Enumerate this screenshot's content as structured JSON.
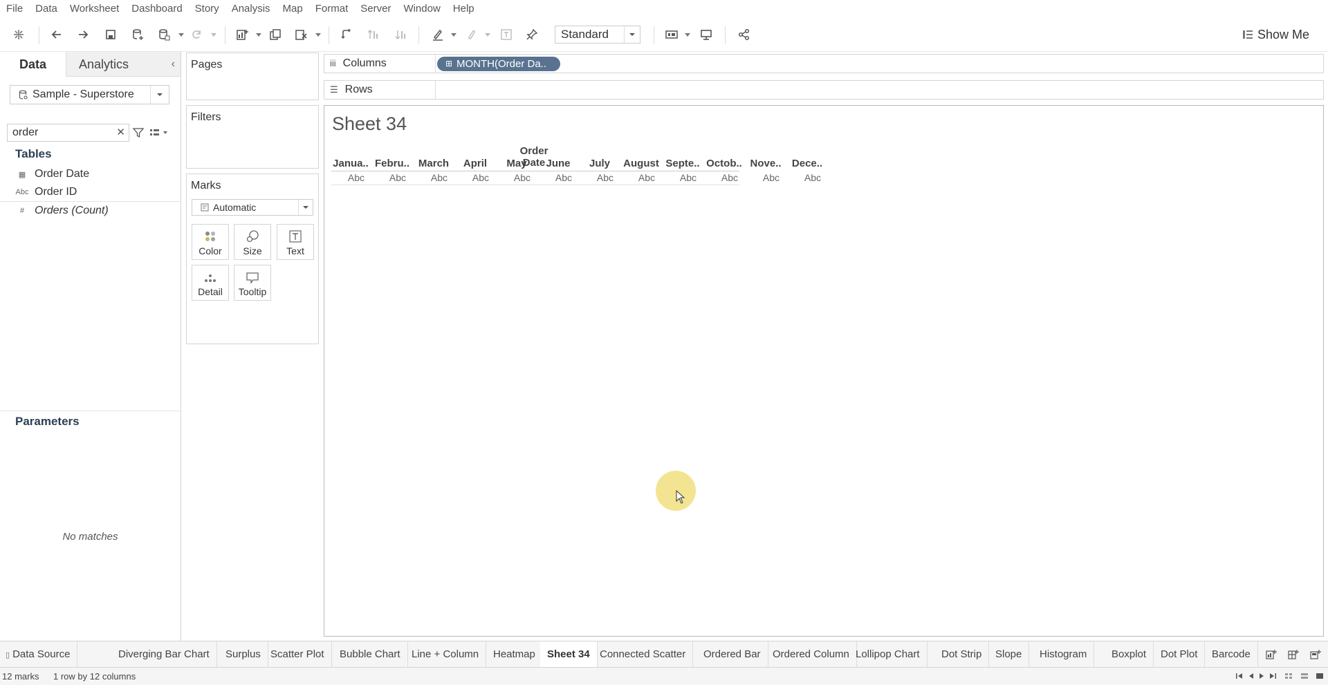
{
  "menu": [
    "File",
    "Data",
    "Worksheet",
    "Dashboard",
    "Story",
    "Analysis",
    "Map",
    "Format",
    "Server",
    "Window",
    "Help"
  ],
  "toolbar": {
    "fit_value": "Standard",
    "show_me_label": "Show Me"
  },
  "left_pane": {
    "tab_data": "Data",
    "tab_analytics": "Analytics",
    "collapse_glyph": "‹",
    "datasource": "Sample - Superstore",
    "search_value": "order",
    "tables_title": "Tables",
    "fields": [
      {
        "name": "Order Date",
        "type_glyph": "▦",
        "icon": "date-icon"
      },
      {
        "name": "Order ID",
        "type_glyph": "Abc",
        "icon": "string-icon"
      },
      {
        "name": "Orders (Count)",
        "type_glyph": "#",
        "icon": "number-icon"
      }
    ],
    "parameters_title": "Parameters",
    "no_matches": "No matches"
  },
  "cards": {
    "pages": "Pages",
    "filters": "Filters",
    "marks": "Marks",
    "mark_type": "Automatic",
    "mark_buttons": [
      "Color",
      "Size",
      "Text",
      "Detail",
      "Tooltip"
    ]
  },
  "shelves": {
    "columns_label": "Columns",
    "rows_label": "Rows",
    "columns_pill": "MONTH(Order Da..",
    "columns_icon": "iii",
    "rows_icon": "☰",
    "pill_glyph": "⊞"
  },
  "view": {
    "sheet_title": "Sheet 34",
    "field_header": "Order Date",
    "months": [
      "Janua..",
      "Febru..",
      "March",
      "April",
      "May",
      "June",
      "July",
      "August",
      "Septe..",
      "Octob..",
      "Nove..",
      "Dece.."
    ],
    "cell_value": "Abc"
  },
  "sheet_tabs": {
    "data_source": "Data Source",
    "tabs": [
      "Diverging Bar Chart",
      "Surplus",
      "Scatter Plot",
      "Bubble Chart",
      "Line + Column",
      "Heatmap",
      "Sheet 34",
      "Connected Scatter",
      "Ordered Bar",
      "Ordered Column",
      "Lollipop Chart",
      "Dot Strip",
      "Slope",
      "Histogram",
      "Boxplot",
      "Dot Plot",
      "Barcode"
    ],
    "active": "Sheet 34"
  },
  "status": {
    "marks": "12 marks",
    "dims": "1 row by 12 columns"
  },
  "colors": {
    "pill": "#59728f",
    "cursor_highlight": "#f1df7f",
    "section_title": "#2b3f54"
  }
}
